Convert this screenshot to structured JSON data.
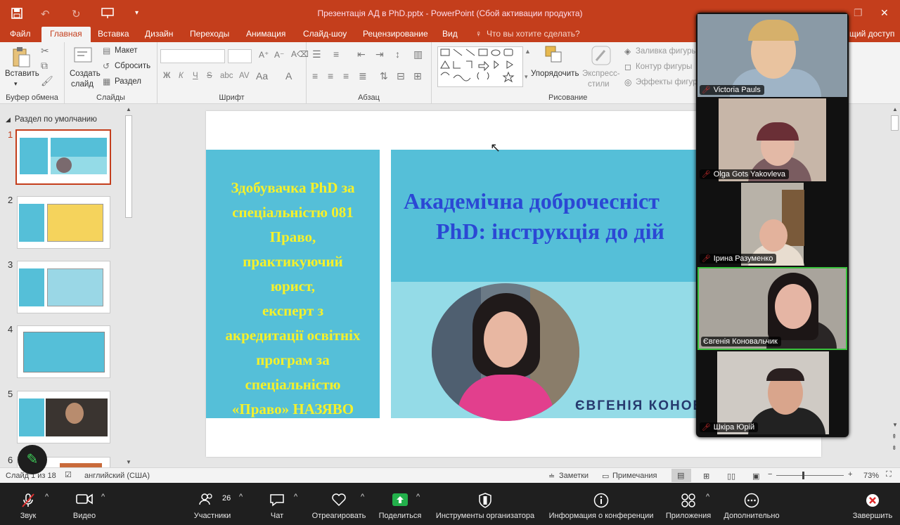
{
  "title_bar": {
    "title": "Презентація АД в PhD.pptx - PowerPoint (Сбой активации продукта)",
    "save_icon": "save-icon",
    "undo_icon": "undo-icon",
    "redo_icon": "redo-icon"
  },
  "menu": {
    "items": [
      "Файл",
      "Главная",
      "Вставка",
      "Дизайн",
      "Переходы",
      "Анимация",
      "Слайд-шоу",
      "Рецензирование",
      "Вид"
    ],
    "active": "Главная",
    "tell_me": "Что вы хотите сделать?",
    "share_partial": "щий доступ"
  },
  "ribbon": {
    "clipboard": {
      "label": "Буфер обмена",
      "paste": "Вставить"
    },
    "slides": {
      "label": "Слайды",
      "new_slide_1": "Создать",
      "new_slide_2": "слайд",
      "layout": "Макет",
      "reset": "Сбросить",
      "section": "Раздел"
    },
    "font": {
      "label": "Шрифт",
      "bold": "Ж",
      "italic": "К",
      "underline": "Ч",
      "strike": "S",
      "shadow": "abc",
      "spacing": "AV"
    },
    "paragraph": {
      "label": "Абзац"
    },
    "drawing": {
      "label": "Рисование",
      "arrange": "Упорядочить",
      "quick_styles_1": "Экспресс-",
      "quick_styles_2": "стили",
      "fill": "Заливка фигуры",
      "outline": "Контур фигуры",
      "effects": "Эффекты фигур"
    }
  },
  "slide_pane": {
    "section": "Раздел по умолчанию",
    "thumbs": [
      {
        "num": "1",
        "selected": true
      },
      {
        "num": "2",
        "selected": false
      },
      {
        "num": "3",
        "selected": false
      },
      {
        "num": "4",
        "selected": false
      },
      {
        "num": "5",
        "selected": false
      },
      {
        "num": "6",
        "selected": false
      }
    ]
  },
  "slide": {
    "left_lines": [
      "Здобувачка PhD за",
      "спеціальністю 081",
      "Право,",
      "практикуючий",
      "юрист,",
      "експерт з",
      "акредитації освітніх",
      "програм за",
      "спеціальністю",
      "«Право» НАЗЯВО"
    ],
    "title_line_1": "Академічна доброчесніст",
    "title_line_2": "PhD: інструкція до дій",
    "name_text": "ЄВГЕНІЯ КОНОВ",
    "colors": {
      "box": "#55bfd8",
      "left_text": "#f6f12a",
      "title_text": "#2b48d4",
      "photo_band": "#94dbe7"
    }
  },
  "status_bar": {
    "slide_count": "Слайд 1 из 18",
    "language": "английский (США)",
    "notes": "Заметки",
    "comments": "Примечания",
    "zoom": "73%"
  },
  "zoom_toolbar": {
    "audio": "Звук",
    "video": "Видео",
    "participants": "Участники",
    "participants_count": "26",
    "chat": "Чат",
    "react": "Отреагировать",
    "share": "Поделиться",
    "host_tools": "Инструменты организатора",
    "meeting_info": "Информация о конференции",
    "apps": "Приложения",
    "more": "Дополнительно",
    "end": "Завершить"
  },
  "participants": [
    {
      "name": "Victoria Pauls",
      "muted": true,
      "speaking": false
    },
    {
      "name": "Olga Gots Yakovleva",
      "muted": true,
      "speaking": false
    },
    {
      "name": "Ірина Разуменко",
      "muted": true,
      "speaking": false
    },
    {
      "name": "Євгенія Коновальчик",
      "muted": false,
      "speaking": true
    },
    {
      "name": "Шкіра Юрій",
      "muted": true,
      "speaking": false
    }
  ]
}
